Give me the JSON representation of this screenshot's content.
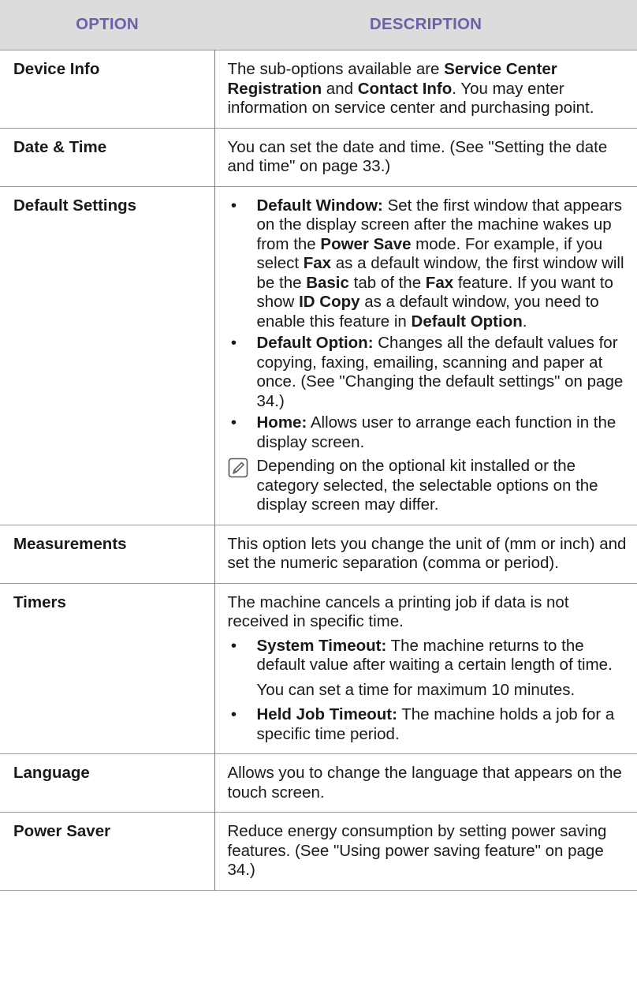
{
  "header": {
    "option": "OPTION",
    "description": "DESCRIPTION"
  },
  "rows": {
    "device_info": {
      "option": "Device Info",
      "t1": "The sub-options available are ",
      "b1": "Service Center Registration",
      "t2": " and ",
      "b2": "Contact Info",
      "t3": ". You may enter information on service center and purchasing point."
    },
    "date_time": {
      "option": "Date & Time",
      "text": "You can set the date and time. (See \"Setting the date and time\" on page 33.)"
    },
    "default_settings": {
      "option": "Default Settings",
      "bullet1": {
        "label": "Default Window:",
        "t1": " Set the first window that appears on the display screen after the machine wakes up from the ",
        "b1": "Power Save",
        "t2": " mode. For example, if you select ",
        "b2": "Fax",
        "t3": " as a default window, the first window will be the ",
        "b3": "Basic",
        "t4": " tab of the ",
        "b4": "Fax",
        "t5": " feature. If you want to show ",
        "b5": "ID Copy",
        "t6": " as a default window, you need to enable this feature in ",
        "b6": "Default Option",
        "t7": "."
      },
      "bullet2": {
        "label": "Default Option:",
        "text": " Changes all the default values for copying, faxing, emailing, scanning and paper at once. (See \"Changing the default settings\" on page 34.)"
      },
      "bullet3": {
        "label": "Home:",
        "text": " Allows user to arrange each function in the display screen."
      },
      "note": "Depending on the optional kit installed or the category selected, the selectable options on the display screen may differ."
    },
    "measurements": {
      "option": "Measurements",
      "text": "This option lets you change the unit of (mm or inch) and set the numeric separation (comma or period)."
    },
    "timers": {
      "option": "Timers",
      "intro": "The machine cancels a printing job if data is not received in specific time.",
      "bullet1": {
        "label": "System Timeout:",
        "text": " The machine returns to the default value after waiting a certain length of time."
      },
      "sub": "You can set a time for maximum 10 minutes.",
      "bullet2": {
        "label": "Held Job Timeout:",
        "text": " The machine holds a job for a specific time period."
      }
    },
    "language": {
      "option": "Language",
      "text": "Allows you to change the language that appears on the touch screen."
    },
    "power_saver": {
      "option": "Power Saver",
      "text": "Reduce energy consumption by setting power saving features. (See \"Using power saving feature\" on page 34.)"
    }
  }
}
